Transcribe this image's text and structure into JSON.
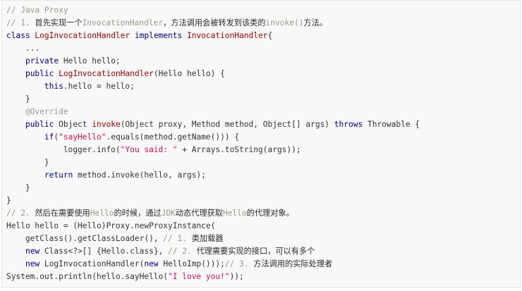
{
  "code_block": {
    "language": "java",
    "lines": [
      [
        {
          "t": "// Java Proxy",
          "c": "comment"
        }
      ],
      [
        {
          "t": "// 1. ",
          "c": "comment"
        },
        {
          "t": "首先实现一个",
          "c": "comment-zh"
        },
        {
          "t": "InvocationHandler",
          "c": "comment"
        },
        {
          "t": "，方法调用会被转发到该类的",
          "c": "comment-zh"
        },
        {
          "t": "invoke()",
          "c": "comment"
        },
        {
          "t": "方法。",
          "c": "comment-zh"
        }
      ],
      [
        {
          "t": "class ",
          "c": "keyword"
        },
        {
          "t": "LogInvocationHandler",
          "c": "method"
        },
        {
          "t": " implements ",
          "c": "keyword"
        },
        {
          "t": "InvocationHandler",
          "c": "method"
        },
        {
          "t": "{",
          "c": "plain"
        }
      ],
      [
        {
          "t": "    ...",
          "c": "plain"
        }
      ],
      [
        {
          "t": "    ",
          "c": "plain"
        },
        {
          "t": "private",
          "c": "keyword"
        },
        {
          "t": " Hello hello;",
          "c": "plain"
        }
      ],
      [
        {
          "t": "    ",
          "c": "plain"
        },
        {
          "t": "public",
          "c": "keyword"
        },
        {
          "t": " ",
          "c": "plain"
        },
        {
          "t": "LogInvocationHandler",
          "c": "method"
        },
        {
          "t": "(Hello hello) {",
          "c": "plain"
        }
      ],
      [
        {
          "t": "        ",
          "c": "plain"
        },
        {
          "t": "this",
          "c": "this"
        },
        {
          "t": ".hello = hello;",
          "c": "plain"
        }
      ],
      [
        {
          "t": "    }",
          "c": "plain"
        }
      ],
      [
        {
          "t": "    ",
          "c": "plain"
        },
        {
          "t": "@Override",
          "c": "annotation"
        }
      ],
      [
        {
          "t": "    ",
          "c": "plain"
        },
        {
          "t": "public",
          "c": "keyword"
        },
        {
          "t": " Object ",
          "c": "plain"
        },
        {
          "t": "invoke",
          "c": "method"
        },
        {
          "t": "(Object proxy, Method method, Object[] args) ",
          "c": "plain"
        },
        {
          "t": "throws",
          "c": "keyword"
        },
        {
          "t": " Throwable {",
          "c": "plain"
        }
      ],
      [
        {
          "t": "        ",
          "c": "plain"
        },
        {
          "t": "if",
          "c": "keyword"
        },
        {
          "t": "(",
          "c": "plain"
        },
        {
          "t": "\"sayHello\"",
          "c": "string"
        },
        {
          "t": ".equals(method.getName())) {",
          "c": "plain"
        }
      ],
      [
        {
          "t": "            logger.info(",
          "c": "plain"
        },
        {
          "t": "\"You said: \"",
          "c": "string"
        },
        {
          "t": " + Arrays.toString(args));",
          "c": "plain"
        }
      ],
      [
        {
          "t": "        }",
          "c": "plain"
        }
      ],
      [
        {
          "t": "        ",
          "c": "plain"
        },
        {
          "t": "return",
          "c": "keyword"
        },
        {
          "t": " method.invoke(hello, args);",
          "c": "plain"
        }
      ],
      [
        {
          "t": "    }",
          "c": "plain"
        }
      ],
      [
        {
          "t": "}",
          "c": "plain"
        }
      ],
      [
        {
          "t": "// 2. ",
          "c": "comment"
        },
        {
          "t": "然后在需要使用",
          "c": "comment-zh"
        },
        {
          "t": "Hello",
          "c": "comment"
        },
        {
          "t": "的时候，通过",
          "c": "comment-zh"
        },
        {
          "t": "JDK",
          "c": "comment"
        },
        {
          "t": "动态代理获取",
          "c": "comment-zh"
        },
        {
          "t": "Hello",
          "c": "comment"
        },
        {
          "t": "的代理对象。",
          "c": "comment-zh"
        }
      ],
      [
        {
          "t": "Hello hello = (Hello)Proxy.newProxyInstance(",
          "c": "plain"
        }
      ],
      [
        {
          "t": "    getClass().getClassLoader(), ",
          "c": "plain"
        },
        {
          "t": "// 1. ",
          "c": "comment"
        },
        {
          "t": "类加载器",
          "c": "comment-zh"
        }
      ],
      [
        {
          "t": "    ",
          "c": "plain"
        },
        {
          "t": "new",
          "c": "keyword"
        },
        {
          "t": " Class<?>[] {Hello.class}, ",
          "c": "plain"
        },
        {
          "t": "// 2. ",
          "c": "comment"
        },
        {
          "t": "代理需要实现的接口，可以有多个",
          "c": "comment-zh"
        }
      ],
      [
        {
          "t": "    ",
          "c": "plain"
        },
        {
          "t": "new",
          "c": "keyword"
        },
        {
          "t": " LogInvocationHandler(",
          "c": "plain"
        },
        {
          "t": "new",
          "c": "keyword"
        },
        {
          "t": " HelloImp()));",
          "c": "plain"
        },
        {
          "t": "// 3. ",
          "c": "comment"
        },
        {
          "t": "方法调用的实际处理者",
          "c": "comment-zh"
        }
      ],
      [
        {
          "t": "System.out.println(hello.sayHello(",
          "c": "plain"
        },
        {
          "t": "\"I love you!\"",
          "c": "string"
        },
        {
          "t": "));",
          "c": "plain"
        }
      ]
    ]
  }
}
